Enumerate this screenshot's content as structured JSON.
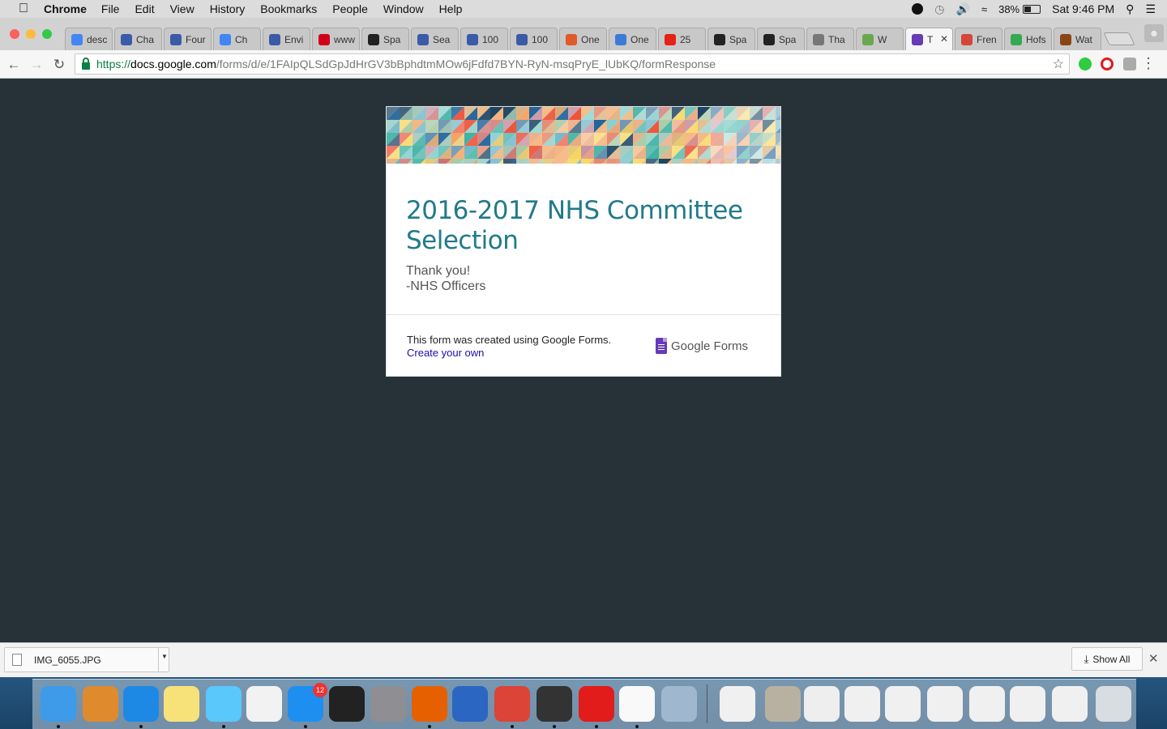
{
  "menubar": {
    "app_name": "Chrome",
    "menus": [
      "File",
      "Edit",
      "View",
      "History",
      "Bookmarks",
      "People",
      "Window",
      "Help"
    ],
    "battery": "38%",
    "clock": "Sat 9:46 PM"
  },
  "tabs": [
    {
      "label": "desc",
      "icon": "google-icon",
      "color": "#4285f4"
    },
    {
      "label": "Cha",
      "icon": "quora-icon",
      "color": "#3b5ba8"
    },
    {
      "label": "Four",
      "icon": "quora-icon",
      "color": "#3b5ba8"
    },
    {
      "label": "Ch",
      "icon": "google-docs-icon",
      "color": "#4285f4"
    },
    {
      "label": "Envi",
      "icon": "quora-icon",
      "color": "#3b5ba8"
    },
    {
      "label": "www",
      "icon": "mcgraw-hill-icon",
      "color": "#d0021b"
    },
    {
      "label": "Spa",
      "icon": "spark-icon",
      "color": "#222"
    },
    {
      "label": "Sea",
      "icon": "quora-icon",
      "color": "#3b5ba8"
    },
    {
      "label": "100",
      "icon": "quora-icon",
      "color": "#3b5ba8"
    },
    {
      "label": "100",
      "icon": "quora-icon",
      "color": "#3b5ba8"
    },
    {
      "label": "One",
      "icon": "site-icon",
      "color": "#e05a2a"
    },
    {
      "label": "One",
      "icon": "globe-icon",
      "color": "#3b7bd6"
    },
    {
      "label": "25",
      "icon": "youtube-icon",
      "color": "#e62117"
    },
    {
      "label": "Spa",
      "icon": "spark-icon",
      "color": "#222"
    },
    {
      "label": "Spa",
      "icon": "spark-icon",
      "color": "#222"
    },
    {
      "label": "Tha",
      "icon": "document-icon",
      "color": "#777"
    },
    {
      "label": "W",
      "icon": "nbc-icon",
      "color": "#6aa84f"
    },
    {
      "label": "T",
      "icon": "google-forms-icon",
      "color": "#673ab7",
      "active": true
    },
    {
      "label": "Fren",
      "icon": "gmail-icon",
      "color": "#d44638"
    },
    {
      "label": "Hofs",
      "icon": "maps-icon",
      "color": "#34a853"
    },
    {
      "label": "Wat",
      "icon": "film-icon",
      "color": "#8b4513"
    }
  ],
  "address": {
    "scheme": "https://",
    "host": "docs.google.com",
    "path": "/forms/d/e/1FAIpQLSdGpJdHrGV3bBphdtmMOw6jFdfd7BYN-RyN-msqPryE_lUbKQ/formResponse"
  },
  "form": {
    "title": "2016-2017 NHS Committee Selection",
    "confirmation_line1": "Thank you!",
    "confirmation_line2": "-NHS Officers",
    "footer_note": "This form was created using Google Forms.",
    "create_link": "Create your own",
    "logo_text": "Google Forms"
  },
  "downloads": {
    "file_name": "IMG_6055.JPG",
    "show_all": "Show All"
  },
  "dock": {
    "apps": [
      {
        "name": "finder-icon",
        "color": "#3d9be9"
      },
      {
        "name": "calculator-icon",
        "color": "#e08a2e"
      },
      {
        "name": "safari-icon",
        "color": "#1e88e5"
      },
      {
        "name": "notes-icon",
        "color": "#f7e27a"
      },
      {
        "name": "messages-icon",
        "color": "#5ac8fa"
      },
      {
        "name": "itunes-icon",
        "color": "#f2f2f2"
      },
      {
        "name": "app-store-icon",
        "color": "#1f8ef1",
        "badge": "12"
      },
      {
        "name": "activity-monitor-icon",
        "color": "#222"
      },
      {
        "name": "system-preferences-icon",
        "color": "#8e8e93"
      },
      {
        "name": "firefox-icon",
        "color": "#e66000"
      },
      {
        "name": "word-icon",
        "color": "#2b66c2"
      },
      {
        "name": "chrome-icon",
        "color": "#db4437"
      },
      {
        "name": "printer-icon",
        "color": "#333"
      },
      {
        "name": "acrobat-icon",
        "color": "#e21b1b"
      },
      {
        "name": "photos-icon",
        "color": "#f9f9f9"
      },
      {
        "name": "preview-icon",
        "color": "#9fb8d0"
      },
      {
        "name": "doc-thumb-icon",
        "color": "#f0f0f0"
      },
      {
        "name": "doc-thumb-icon",
        "color": "#b8b1a2"
      },
      {
        "name": "doc-thumb-icon",
        "color": "#eeeeee"
      },
      {
        "name": "doc-thumb-icon",
        "color": "#f0f0f0"
      },
      {
        "name": "doc-thumb-icon",
        "color": "#f0f0f0"
      },
      {
        "name": "doc-thumb-icon",
        "color": "#f0f0f0"
      },
      {
        "name": "doc-thumb-icon",
        "color": "#f0f0f0"
      },
      {
        "name": "doc-thumb-icon",
        "color": "#f0f0f0"
      },
      {
        "name": "doc-thumb-icon",
        "color": "#f0f0f0"
      },
      {
        "name": "trash-icon",
        "color": "#d8dde2"
      }
    ]
  }
}
